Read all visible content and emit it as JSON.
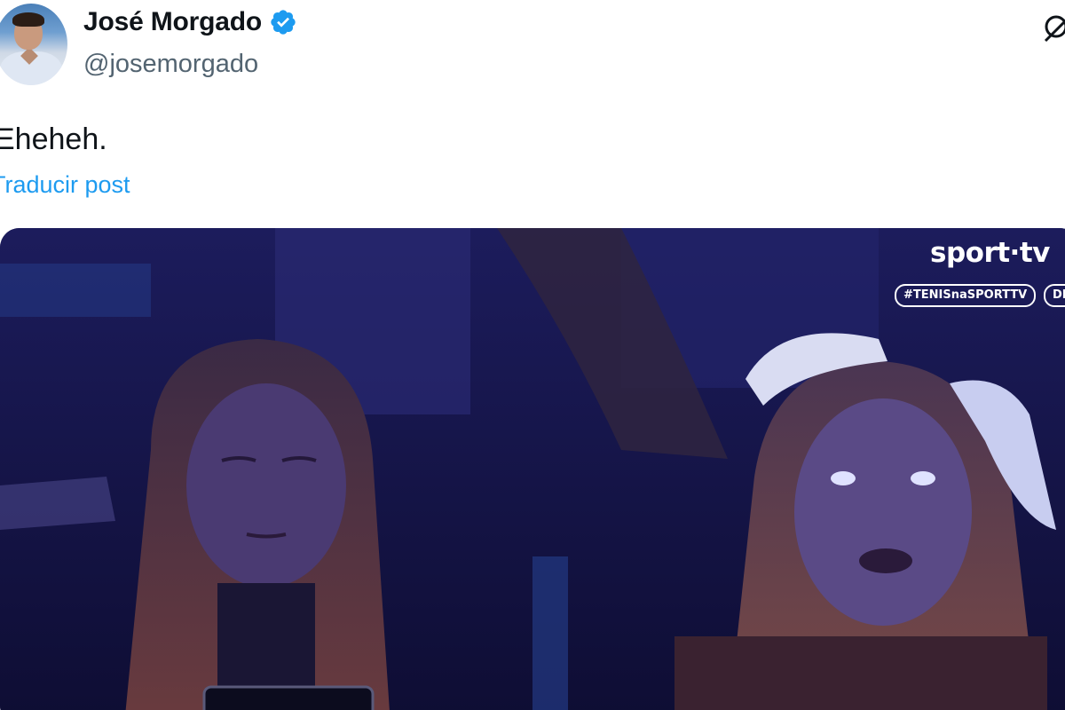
{
  "author": {
    "display_name": "José Morgado",
    "handle": "@josemorgado",
    "verified": true,
    "avatar_icon": "profile-photo"
  },
  "tweet": {
    "text": "Eheheh.",
    "translate_label": "Traducir post"
  },
  "media": {
    "channel_logo": "sport·tv",
    "hashtag": "#TENISnaSPORTTV",
    "live_badge": "DI"
  },
  "colors": {
    "link": "#1d9bf0",
    "verified": "#1d9bf0",
    "secondary_text": "#536471",
    "primary_text": "#0f1419"
  },
  "icons": {
    "verified": "verified-badge-icon",
    "grok": "grok-icon"
  }
}
